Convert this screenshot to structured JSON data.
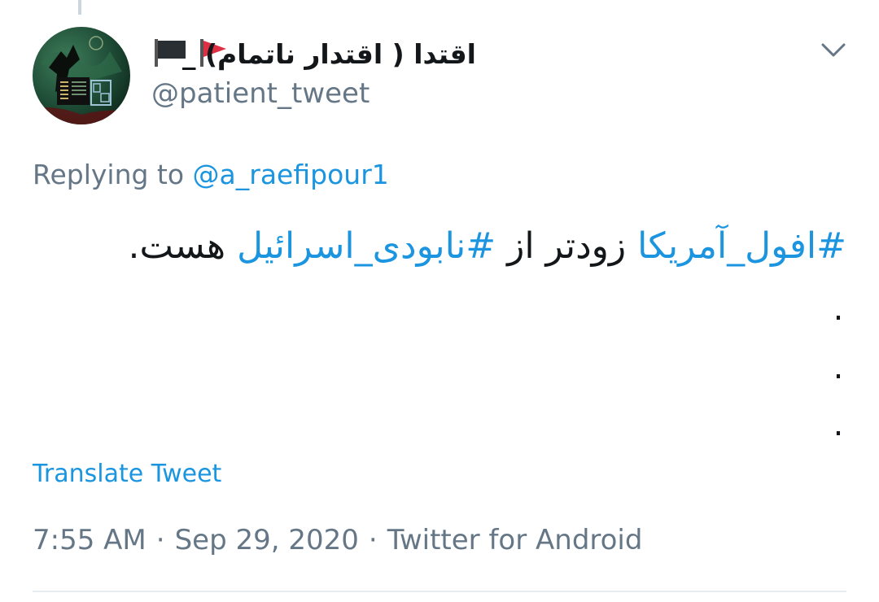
{
  "tweet": {
    "display_name": "اقتدا ( اقتدار ناتمام) _",
    "handle": "@patient_tweet",
    "replying_prefix": "Replying to",
    "replying_mention": "@a_raefipour1",
    "body": {
      "hashtag_1": "#افول_آمریکا",
      "text_1": " زودتر از ",
      "hashtag_2": "#نابودی_اسرائیل",
      "text_2": " هست."
    },
    "dots": [
      ".",
      ".",
      "."
    ],
    "translate_label": "Translate Tweet",
    "time": "7:55 AM",
    "date": "Sep 29, 2020",
    "source": "Twitter for Android",
    "separator": "·"
  },
  "icons": {
    "caret": "chevron-down-icon",
    "flags": [
      "black-flag-icon",
      "red-triangular-flag-icon"
    ]
  },
  "colors": {
    "link": "#1b95e0",
    "secondary_text": "#657786",
    "primary_text": "#14171a",
    "divider": "#e6ecf0"
  }
}
